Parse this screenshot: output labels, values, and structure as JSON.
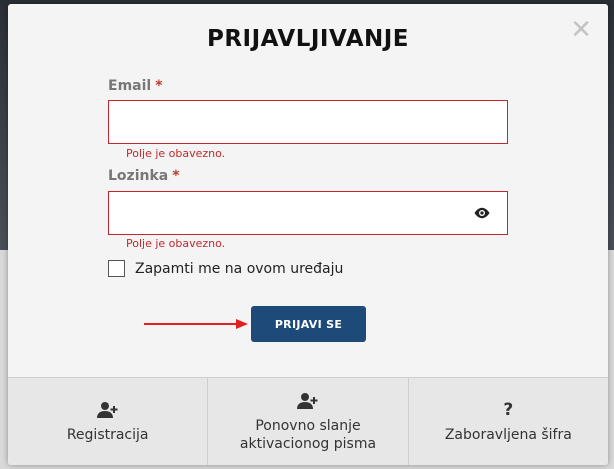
{
  "modal": {
    "title": "PRIJAVLJIVANJE",
    "close_glyph": "✕"
  },
  "form": {
    "email": {
      "label": "Email",
      "required_mark": "*",
      "value": "",
      "error": "Polje je obavezno."
    },
    "password": {
      "label": "Lozinka",
      "required_mark": "*",
      "value": "",
      "error": "Polje je obavezno.",
      "toggle_icon": "eye-icon"
    },
    "remember": {
      "label": "Zapamti me na ovom uređaju",
      "checked": false
    },
    "submit_label": "PRIJAVI SE"
  },
  "footer": {
    "items": [
      {
        "icon": "user-plus-icon",
        "label": "Registracija"
      },
      {
        "icon": "user-plus-icon",
        "label": "Ponovno slanje aktivacionog pisma"
      },
      {
        "icon": "question-icon",
        "label": "Zaboravljena šifra",
        "glyph": "?"
      }
    ]
  },
  "colors": {
    "accent": "#1e4a7a",
    "error": "#c0282d",
    "arrow": "#e02020"
  }
}
